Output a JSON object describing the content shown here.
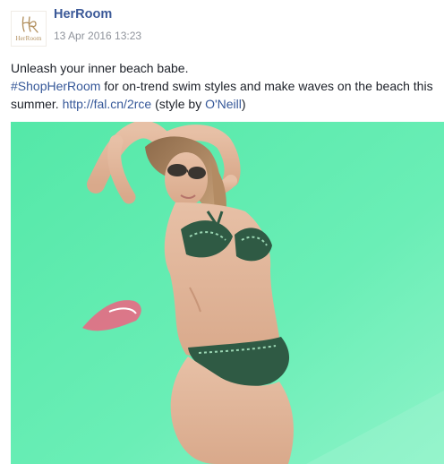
{
  "post": {
    "page_name": "HerRoom",
    "avatar_text": "HerRoom",
    "timestamp": "13 Apr 2016 13:23",
    "text": {
      "line1": "Unleash your inner beach babe.",
      "hashtag": "#ShopHerRoom",
      "line2_middle": " for on-trend swim styles and make waves on the beach this summer. ",
      "link_url": "http://fal.cn/2rce",
      "style_prefix": " (style by ",
      "style_brand": "O'Neill",
      "style_suffix": ")"
    },
    "photo": {
      "background_color": "#62ecb0",
      "subject": "woman-in-bikini-with-sunglasses"
    }
  },
  "colors": {
    "link": "#365899",
    "name": "#3b5998",
    "meta": "#90949c",
    "text": "#1d2129"
  }
}
